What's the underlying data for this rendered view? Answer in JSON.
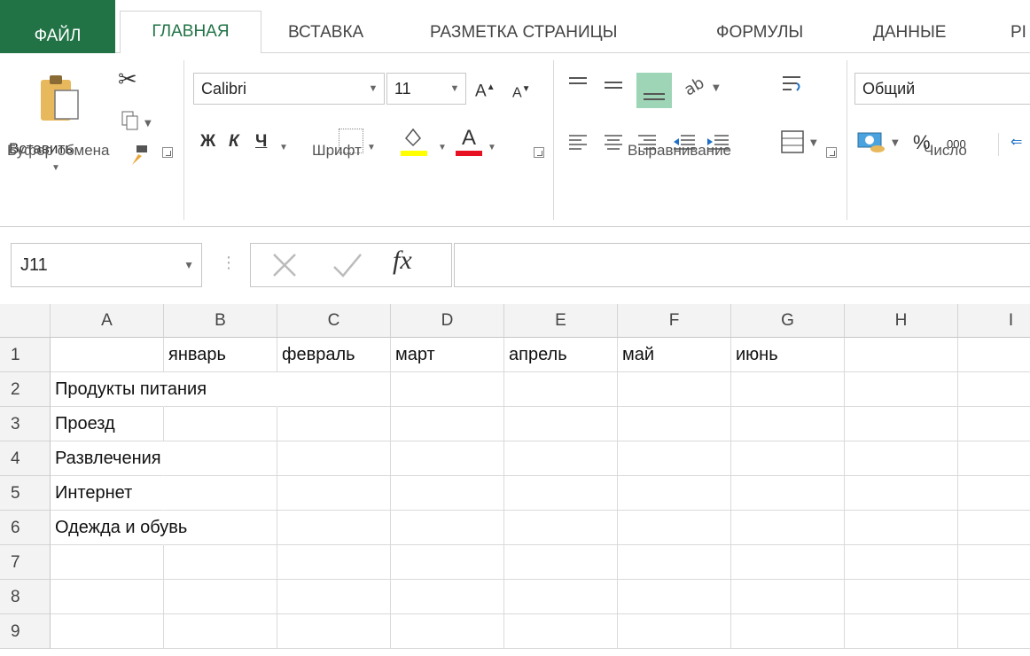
{
  "tabs": {
    "file": "ФАЙЛ",
    "home": "ГЛАВНАЯ",
    "insert": "ВСТАВКА",
    "page_layout": "РАЗМЕТКА СТРАНИЦЫ",
    "formulas": "ФОРМУЛЫ",
    "data": "ДАННЫЕ",
    "partial": "РІ"
  },
  "ribbon": {
    "clipboard": {
      "group_label": "Буфер обмена",
      "paste_label": "Вставить"
    },
    "font": {
      "group_label": "Шрифт",
      "font_name": "Calibri",
      "font_size": "11",
      "bold": "Ж",
      "italic": "К",
      "underline": "Ч"
    },
    "alignment": {
      "group_label": "Выравнивание"
    },
    "number": {
      "group_label": "Число",
      "format": "Общий",
      "percent": "%",
      "thousands": "000"
    }
  },
  "formula_bar": {
    "name_box": "J11",
    "fx": "fx",
    "value": ""
  },
  "sheet": {
    "columns": [
      "A",
      "B",
      "C",
      "D",
      "E",
      "F",
      "G",
      "H",
      "I"
    ],
    "rows": [
      "1",
      "2",
      "3",
      "4",
      "5",
      "6",
      "7",
      "8",
      "9"
    ],
    "cells": {
      "B1": "январь",
      "C1": "февраль",
      "D1": "март",
      "E1": "апрель",
      "F1": "май",
      "G1": "июнь",
      "A2": "Продукты питания",
      "A3": "Проезд",
      "A4": "Развлечения",
      "A5": "Интернет",
      "A6": "Одежда и обувь"
    }
  },
  "colors": {
    "accent": "#217346",
    "highlight_fill": "#9fd5b7",
    "font_color_bar": "#e81123",
    "fill_color_bar": "#ffff00"
  }
}
